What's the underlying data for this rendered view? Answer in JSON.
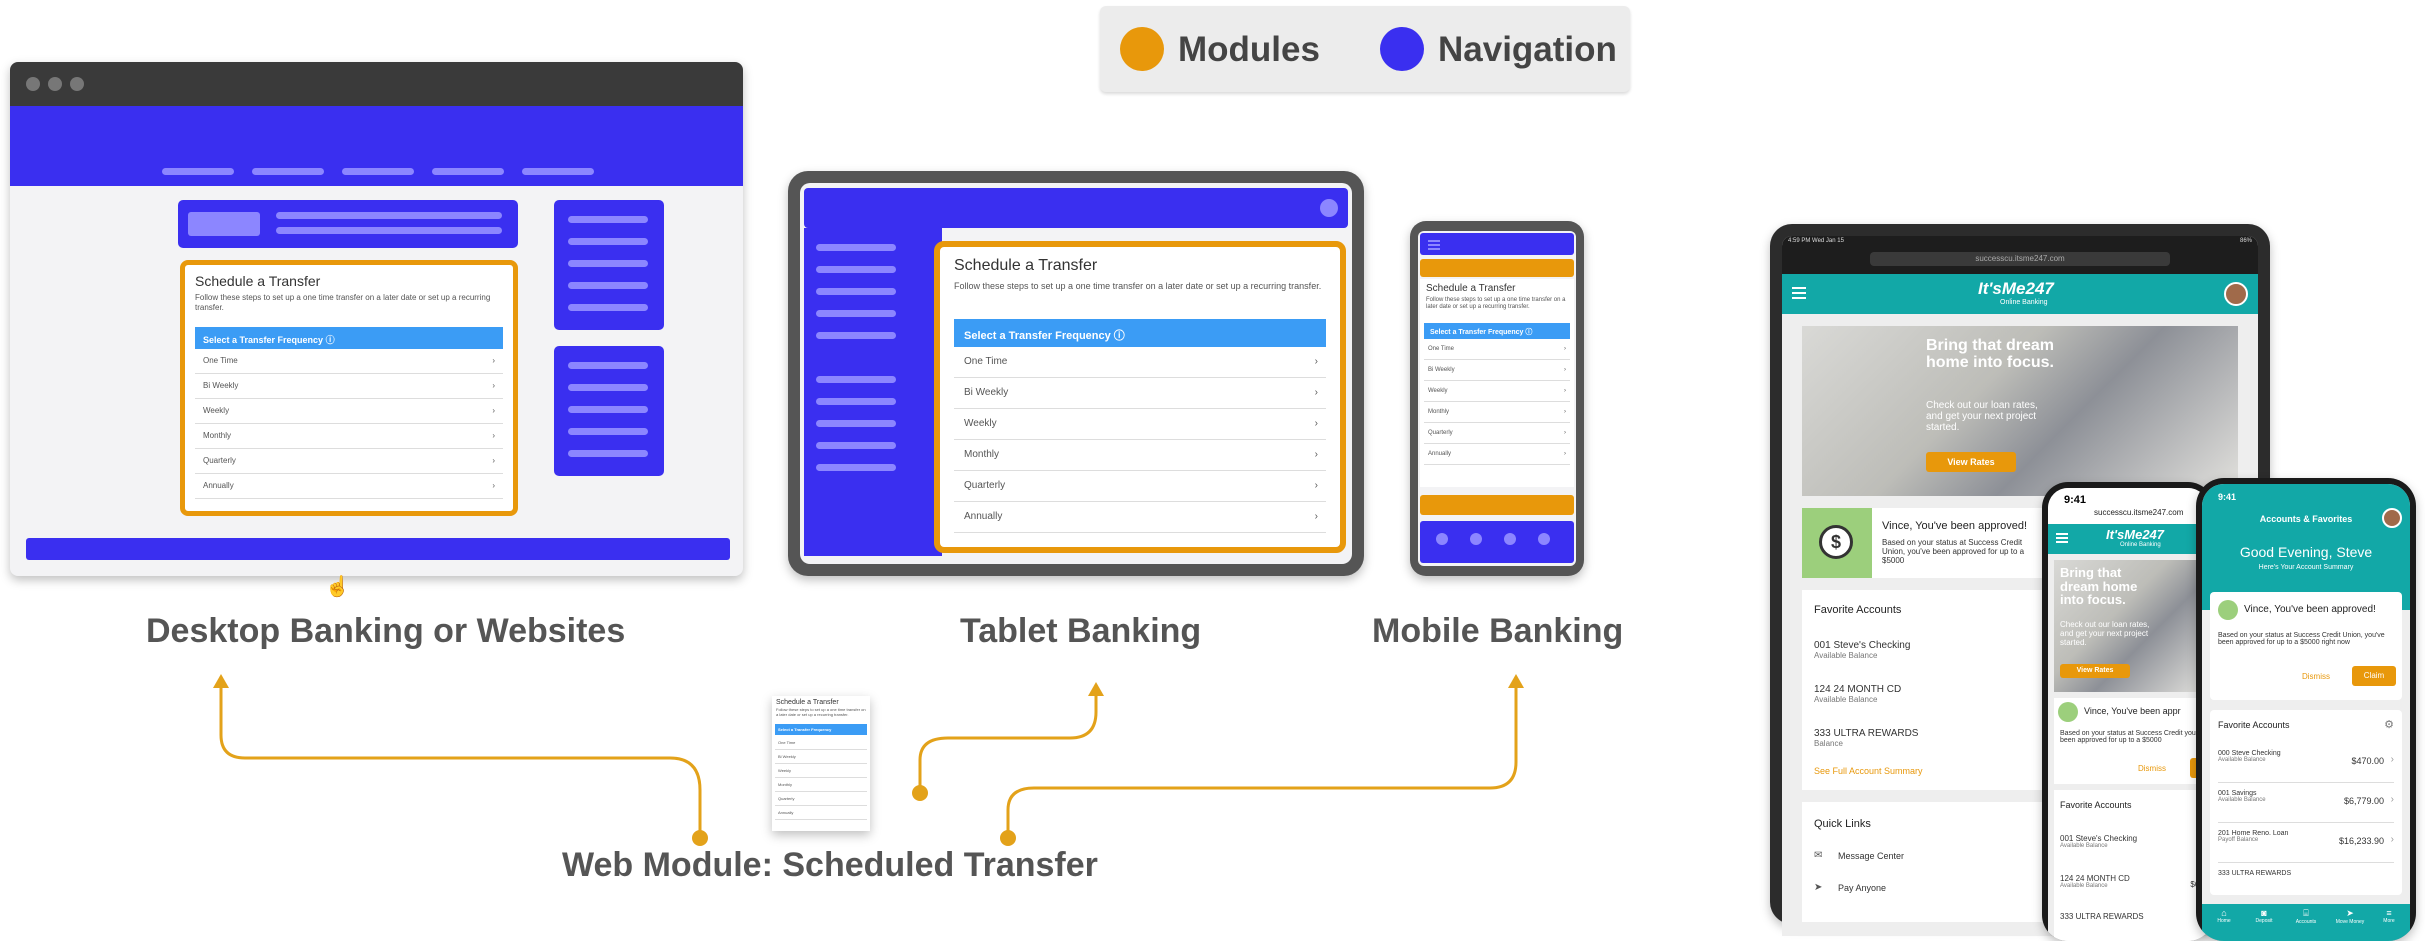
{
  "legend": {
    "modules_label": "Modules",
    "navigation_label": "Navigation",
    "modules_color": "#e8980b",
    "navigation_color": "#3a2ff0"
  },
  "module": {
    "title": "Schedule a Transfer",
    "description": "Follow these steps to set up a one time transfer on a later date or set up a recurring transfer.",
    "frequency_header": "Select a Transfer Frequency",
    "options": [
      "One Time",
      "Bi Weekly",
      "Weekly",
      "Monthly",
      "Quarterly",
      "Annually"
    ]
  },
  "captions": {
    "desktop": "Desktop Banking or Websites",
    "tablet": "Tablet Banking",
    "mobile": "Mobile Banking",
    "web_module": "Web Module: Scheduled Transfer"
  },
  "ipad": {
    "status_time": "4:59 PM  Wed Jan 15",
    "status_battery": "86%",
    "url": "successcu.itsme247.com",
    "brand": "It'sMe247",
    "brand_sub": "Online Banking",
    "hero_title": "Bring that dream home into focus.",
    "hero_body": "Check out our loan rates, and get your next project started.",
    "hero_button": "View Rates",
    "approval_title": "Vince, You've been approved!",
    "approval_body": "Based on your status at Success Credit Union, you've been approved for up to a $5000",
    "favorites_title": "Favorite Accounts",
    "accounts": [
      {
        "name": "001 Steve's Checking",
        "sub": "Available Balance"
      },
      {
        "name": "124 24 MONTH CD",
        "sub": "Available Balance"
      },
      {
        "name": "333 ULTRA REWARDS",
        "sub": "Balance"
      }
    ],
    "see_full": "See Full Account Summary",
    "quick_links_title": "Quick Links",
    "quick_links": [
      "Message Center",
      "Pay Anyone"
    ]
  },
  "phone1": {
    "time": "9:41",
    "url": "successcu.itsme247.com",
    "brand": "It'sMe247",
    "brand_sub": "Online Banking",
    "hero_title": "Bring that dream home into focus.",
    "hero_body": "Check out our loan rates, and get your next project started.",
    "hero_button": "View Rates",
    "approval_title": "Vince, You've been appr",
    "approval_body": "Based on your status at Success Credit you've been approved for up to a $5000",
    "dismiss": "Dismiss",
    "favorites_title": "Favorite Accounts",
    "accounts": [
      {
        "name": "001 Steve's Checking",
        "sub": "Available Balance",
        "amt": "$4"
      },
      {
        "name": "124 24 MONTH CD",
        "sub": "Available Balance",
        "amt": "$6,7"
      },
      {
        "name": "333 ULTRA REWARDS",
        "sub": "",
        "amt": ""
      }
    ]
  },
  "phone2": {
    "time": "9:41",
    "header": "Accounts & Favorites",
    "greeting": "Good Evening, Steve",
    "summary": "Here's Your Account Summary",
    "approval_title": "Vince, You've been approved!",
    "approval_body": "Based on your status at Success Credit Union, you've been approved for up to a $5000 right now",
    "dismiss": "Dismiss",
    "claim": "Claim",
    "favorites_title": "Favorite Accounts",
    "accounts": [
      {
        "name": "000 Steve Checking",
        "sub": "Available Balance",
        "amt": "$470.00"
      },
      {
        "name": "001 Savings",
        "sub": "Available Balance",
        "amt": "$6,779.00"
      },
      {
        "name": "201 Home Reno. Loan",
        "sub": "Payoff Balance",
        "amt": "$16,233.90"
      },
      {
        "name": "333 ULTRA REWARDS",
        "sub": "",
        "amt": ""
      }
    ],
    "tabs": [
      "Home",
      "Deposit",
      "Accounts",
      "Move Money",
      "More"
    ]
  }
}
